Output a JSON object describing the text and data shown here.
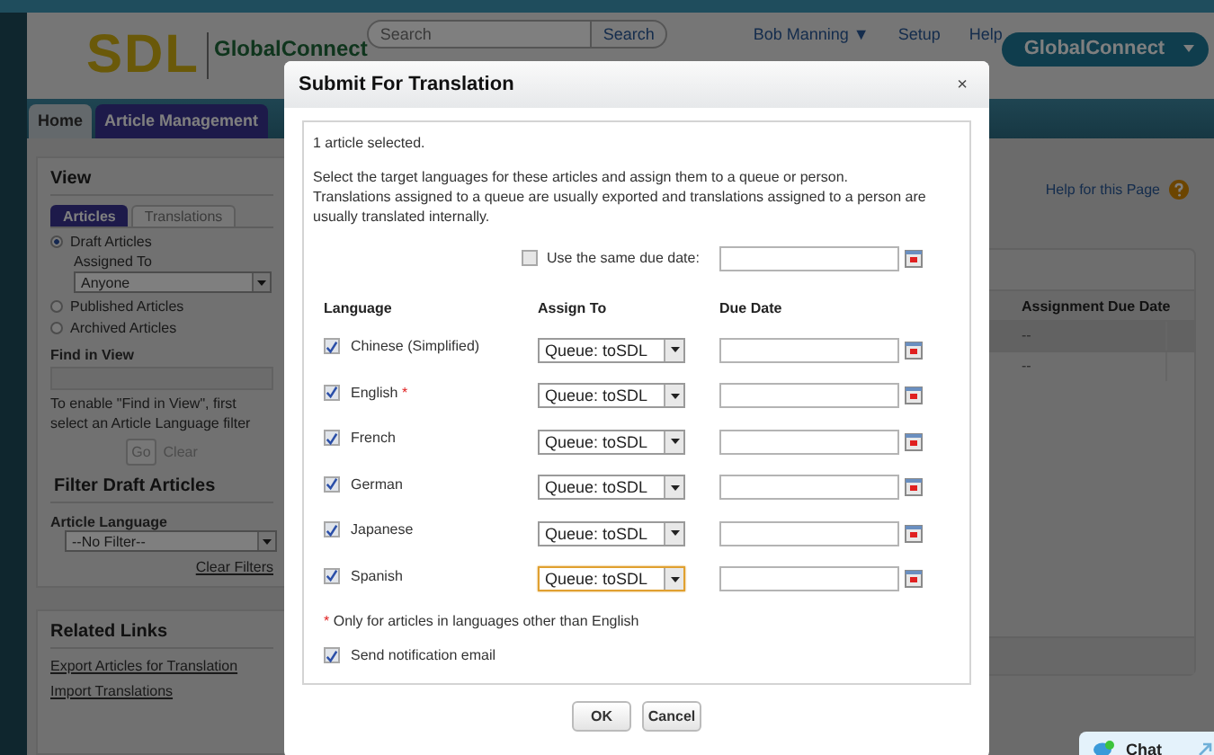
{
  "header": {
    "logo_mark": "SDL",
    "logo_text": "GlobalConnect",
    "search": {
      "placeholder": "Search"
    },
    "search_button": "Search",
    "user_menu": "Bob Manning",
    "user_menu_arrow": "▼",
    "links": [
      "Setup",
      "Help"
    ],
    "app_button": "GlobalConnect"
  },
  "tabs": [
    {
      "label": "Home",
      "selected": false
    },
    {
      "label": "Article Management",
      "selected": true
    }
  ],
  "view_panel": {
    "title": "View",
    "tabs": [
      {
        "label": "Articles",
        "selected": true
      },
      {
        "label": "Translations",
        "selected": false
      }
    ],
    "options": [
      {
        "label": "Draft Articles",
        "selected": true,
        "assigned_to": {
          "label": "Assigned To",
          "value": "Anyone"
        }
      },
      {
        "label": "Published Articles",
        "selected": false
      },
      {
        "label": "Archived Articles",
        "selected": false
      }
    ],
    "find_label": "Find in View",
    "find_hint": "To enable \"Find in View\", first select an Article Language filter",
    "go_button": {
      "label": "Go",
      "disabled": true
    },
    "clear_button": {
      "label": "Clear",
      "disabled": true
    }
  },
  "filter_panel": {
    "title": "Filter Draft Articles",
    "language_label": "Article Language",
    "language": "--No Filter--",
    "clear_filters": "Clear Filters"
  },
  "related_links": {
    "title": "Related Links",
    "links": [
      "Export Articles for Translation",
      "Import Translations"
    ]
  },
  "help_link": "Help for this Page",
  "table": {
    "columns": [
      "Assignment Due Date"
    ],
    "rows": [
      [
        "--"
      ],
      [
        "--"
      ]
    ]
  },
  "dialog": {
    "title": "Submit For Translation",
    "close": "×",
    "selected_count": "1 article selected.",
    "instructions": [
      "Select the target languages for these articles and assign them to a queue or person.",
      "Translations assigned to a queue are usually exported and translations assigned to a person are usually translated internally."
    ],
    "same_due_date": {
      "label": "Use the same due date:",
      "checked": false
    },
    "columns": [
      "Language",
      "Assign To",
      "Due Date"
    ],
    "languages": [
      {
        "name": "Chinese (Simplified)",
        "checked": true,
        "footnote": false,
        "assign_to": "Queue: toSDL",
        "focused": false
      },
      {
        "name": "English",
        "checked": true,
        "footnote": true,
        "assign_to": "Queue: toSDL",
        "focused": false
      },
      {
        "name": "French",
        "checked": true,
        "footnote": false,
        "assign_to": "Queue: toSDL",
        "focused": false
      },
      {
        "name": "German",
        "checked": true,
        "footnote": false,
        "assign_to": "Queue: toSDL",
        "focused": false
      },
      {
        "name": "Japanese",
        "checked": true,
        "footnote": false,
        "assign_to": "Queue: toSDL",
        "focused": false
      },
      {
        "name": "Spanish",
        "checked": true,
        "footnote": false,
        "assign_to": "Queue: toSDL",
        "focused": true
      }
    ],
    "footnote_mark": "*",
    "footnote": "Only for articles in languages other than English",
    "notify": {
      "label": "Send notification email",
      "checked": true
    },
    "buttons": [
      "OK",
      "Cancel"
    ]
  },
  "chat": {
    "label": "Chat"
  }
}
